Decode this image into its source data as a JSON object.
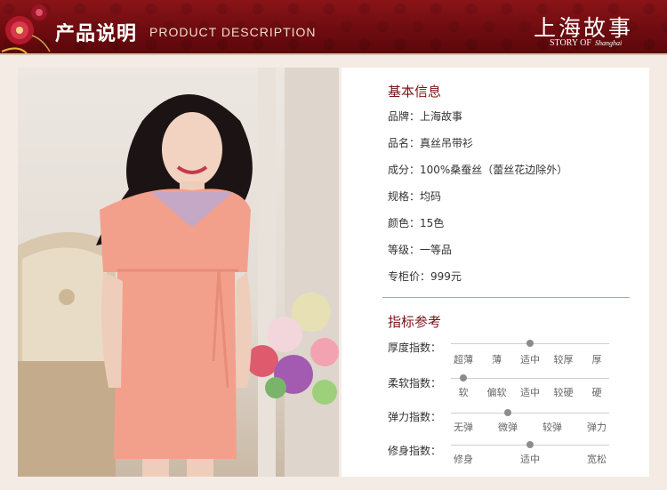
{
  "header": {
    "title_cn": "产品说明",
    "title_en": "PRODUCT DESCRIPTION",
    "brand_cn": "上海故事",
    "brand_en": "STORY OF",
    "brand_en_script": "Shanghai"
  },
  "colors": {
    "banner": "#6e0c10",
    "accent": "#7a1418",
    "divider": "#c9a37a",
    "dress": "#f2a08c"
  },
  "basic_info": {
    "title": "基本信息",
    "rows": [
      "品牌：上海故事",
      "品名：真丝吊带衫",
      "成分：100%桑蚕丝（蕾丝花边除外）",
      "规格：均码",
      "颜色：15色",
      "等级：一等品",
      "专柜价：999元"
    ]
  },
  "indicators": {
    "title": "指标参考",
    "items": [
      {
        "label": "厚度指数：",
        "options": [
          "超薄",
          "薄",
          "适中",
          "较厚",
          "厚"
        ],
        "selected_index": 2
      },
      {
        "label": "柔软指数：",
        "options": [
          "软",
          "偏软",
          "适中",
          "较硬",
          "硬"
        ],
        "selected_index": 0
      },
      {
        "label": "弹力指数：",
        "options": [
          "无弹",
          "微弹",
          "较弹",
          "弹力"
        ],
        "selected_index": 1
      },
      {
        "label": "修身指数：",
        "options": [
          "修身",
          "适中",
          "宽松"
        ],
        "selected_index": 1
      }
    ]
  }
}
